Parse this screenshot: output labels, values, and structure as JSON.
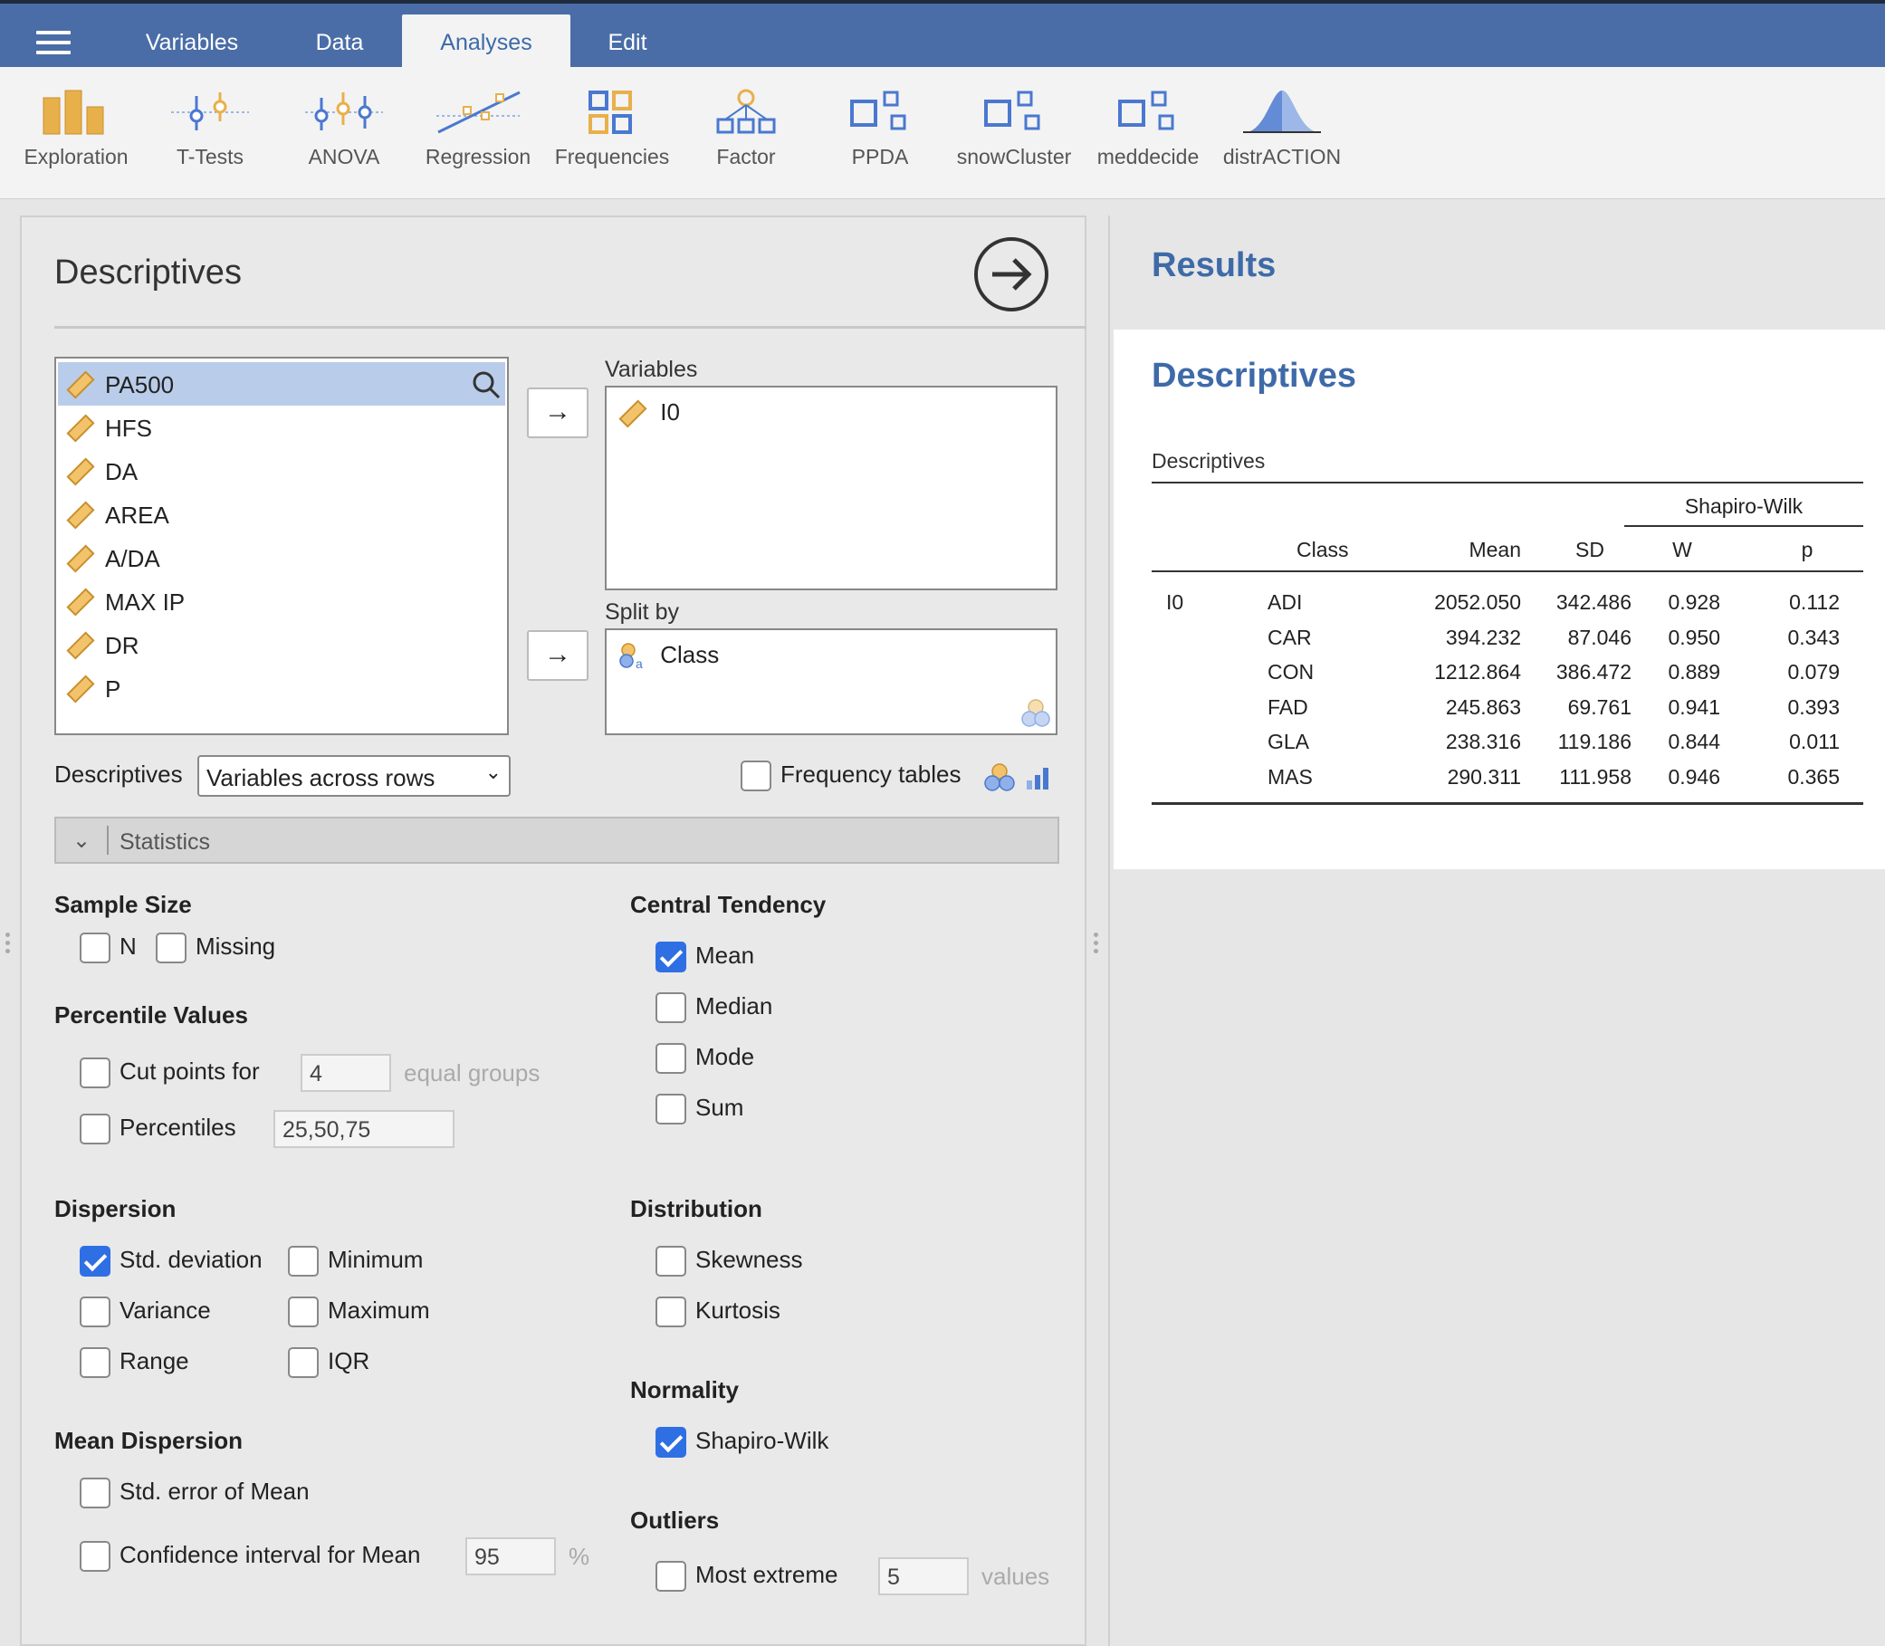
{
  "menubar": {
    "tabs": [
      {
        "label": "Variables",
        "active": false
      },
      {
        "label": "Data",
        "active": false
      },
      {
        "label": "Analyses",
        "active": true
      },
      {
        "label": "Edit",
        "active": false
      }
    ]
  },
  "toolbar": {
    "items": [
      {
        "label": "Exploration",
        "icon": "exploration-icon"
      },
      {
        "label": "T-Tests",
        "icon": "t-tests-icon"
      },
      {
        "label": "ANOVA",
        "icon": "anova-icon"
      },
      {
        "label": "Regression",
        "icon": "regression-icon"
      },
      {
        "label": "Frequencies",
        "icon": "frequencies-icon"
      },
      {
        "label": "Factor",
        "icon": "factor-icon"
      },
      {
        "label": "PPDA",
        "icon": "module-icon"
      },
      {
        "label": "snowCluster",
        "icon": "module-icon"
      },
      {
        "label": "meddecide",
        "icon": "module-icon"
      },
      {
        "label": "distrACTION",
        "icon": "distribution-icon"
      }
    ],
    "colors": {
      "orange": "#e8b04b",
      "blue": "#4a78d0"
    }
  },
  "options": {
    "title": "Descriptives",
    "variable_list": [
      "PA500",
      "HFS",
      "DA",
      "AREA",
      "A/DA",
      "MAX IP",
      "DR",
      "P"
    ],
    "selected_variable": "PA500",
    "variables_label": "Variables",
    "variables": [
      "I0"
    ],
    "split_by_label": "Split by",
    "split_by": [
      "Class"
    ],
    "descriptives_label": "Descriptives",
    "descriptives_value": "Variables across rows",
    "frequency_tables_label": "Frequency tables",
    "statistics_label": "Statistics",
    "sample_size": {
      "title": "Sample Size",
      "n": "N",
      "missing": "Missing"
    },
    "percentile_values": {
      "title": "Percentile Values",
      "cut_points_label": "Cut points for",
      "cut_points_value": "4",
      "equal_groups": "equal groups",
      "percentiles_label": "Percentiles",
      "percentiles_value": "25,50,75"
    },
    "dispersion": {
      "title": "Dispersion",
      "std_deviation": "Std. deviation",
      "variance": "Variance",
      "range": "Range",
      "minimum": "Minimum",
      "maximum": "Maximum",
      "iqr": "IQR"
    },
    "mean_dispersion": {
      "title": "Mean Dispersion",
      "std_error": "Std. error of Mean",
      "ci_label": "Confidence interval for Mean",
      "ci_value": "95",
      "percent": "%"
    },
    "central_tendency": {
      "title": "Central Tendency",
      "mean": "Mean",
      "median": "Median",
      "mode": "Mode",
      "sum": "Sum"
    },
    "distribution": {
      "title": "Distribution",
      "skewness": "Skewness",
      "kurtosis": "Kurtosis"
    },
    "normality": {
      "title": "Normality",
      "shapiro_wilk": "Shapiro-Wilk"
    },
    "outliers": {
      "title": "Outliers",
      "most_extreme": "Most extreme",
      "value": "5",
      "values_label": "values"
    }
  },
  "results": {
    "title": "Results",
    "section_title": "Descriptives",
    "table_caption": "Descriptives",
    "shapiro_header": "Shapiro-Wilk",
    "columns": [
      "Class",
      "Mean",
      "SD",
      "W",
      "p"
    ],
    "variable": "I0",
    "rows": [
      {
        "class": "ADI",
        "mean": "2052.050",
        "sd": "342.486",
        "w": "0.928",
        "p": "0.112"
      },
      {
        "class": "CAR",
        "mean": "394.232",
        "sd": "87.046",
        "w": "0.950",
        "p": "0.343"
      },
      {
        "class": "CON",
        "mean": "1212.864",
        "sd": "386.472",
        "w": "0.889",
        "p": "0.079"
      },
      {
        "class": "FAD",
        "mean": "245.863",
        "sd": "69.761",
        "w": "0.941",
        "p": "0.393"
      },
      {
        "class": "GLA",
        "mean": "238.316",
        "sd": "119.186",
        "w": "0.844",
        "p": "0.011"
      },
      {
        "class": "MAS",
        "mean": "290.311",
        "sd": "111.958",
        "w": "0.946",
        "p": "0.365"
      }
    ]
  }
}
